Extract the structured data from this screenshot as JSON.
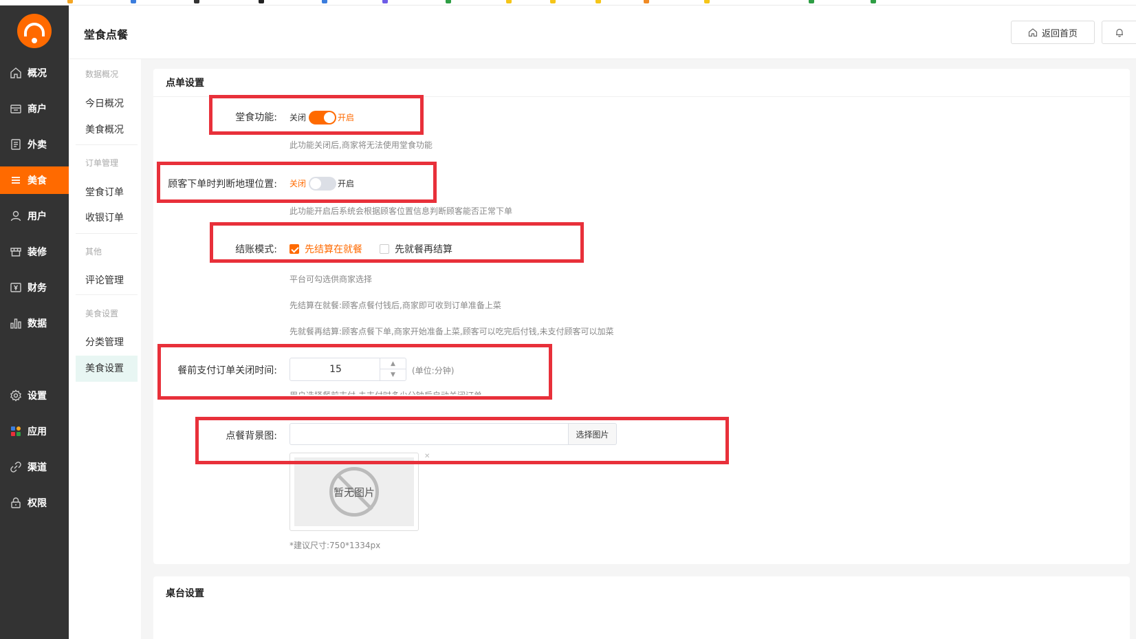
{
  "app": {
    "page_title": "堂食点餐",
    "home_button": "返回首页",
    "accent_color": "#ff6a00"
  },
  "sidebar": {
    "items": [
      {
        "label": "概况",
        "icon": "home-icon"
      },
      {
        "label": "商户",
        "icon": "store-icon"
      },
      {
        "label": "外卖",
        "icon": "document-icon"
      },
      {
        "label": "美食",
        "icon": "menu-lines-icon"
      },
      {
        "label": "用户",
        "icon": "user-icon"
      },
      {
        "label": "装修",
        "icon": "shop-awning-icon"
      },
      {
        "label": "财务",
        "icon": "wallet-icon"
      },
      {
        "label": "数据",
        "icon": "bar-chart-icon"
      },
      {
        "label": "设置",
        "icon": "gear-icon"
      },
      {
        "label": "应用",
        "icon": "apps-icon"
      },
      {
        "label": "渠道",
        "icon": "link-icon"
      },
      {
        "label": "权限",
        "icon": "lock-icon"
      }
    ],
    "active": "美食"
  },
  "subnav": {
    "groups": [
      {
        "title": "数据概况",
        "items": [
          "今日概况",
          "美食概况"
        ]
      },
      {
        "title": "订单管理",
        "items": [
          "堂食订单",
          "收银订单"
        ]
      },
      {
        "title": "其他",
        "items": [
          "评论管理"
        ]
      },
      {
        "title": "美食设置",
        "items": [
          "分类管理",
          "美食设置"
        ]
      }
    ],
    "active": "美食设置"
  },
  "order_settings": {
    "section_title": "点单设置",
    "dine_in": {
      "label": "堂食功能:",
      "off_text": "关闭",
      "on_text": "开启",
      "enabled": true,
      "hint": "此功能关闭后,商家将无法使用堂食功能"
    },
    "location_check": {
      "label": "顾客下单时判断地理位置:",
      "off_text": "关闭",
      "on_text": "开启",
      "enabled": false,
      "hint": "此功能开启后系统会根据顾客位置信息判断顾客能否正常下单"
    },
    "checkout_mode": {
      "label": "结账模式:",
      "options": [
        {
          "label": "先结算在就餐",
          "checked": true
        },
        {
          "label": "先就餐再结算",
          "checked": false
        }
      ],
      "hints": [
        "平台可勾选供商家选择",
        "先结算在就餐:顾客点餐付钱后,商家即可收到订单准备上菜",
        "先就餐再结算:顾客点餐下单,商家开始准备上菜,顾客可以吃完后付钱,未支付顾客可以加菜"
      ]
    },
    "prepay_close_time": {
      "label": "餐前支付订单关闭时间:",
      "value": "15",
      "unit": "(单位:分钟)",
      "hint": "用户选择餐前支付,未支付时多少分钟后自动关闭订单"
    },
    "background_image": {
      "label": "点餐背景图:",
      "select_button": "选择图片",
      "placeholder_text": "暂无图片",
      "size_hint": "*建议尺寸:750*1334px"
    }
  },
  "table_settings": {
    "section_title": "桌台设置"
  }
}
